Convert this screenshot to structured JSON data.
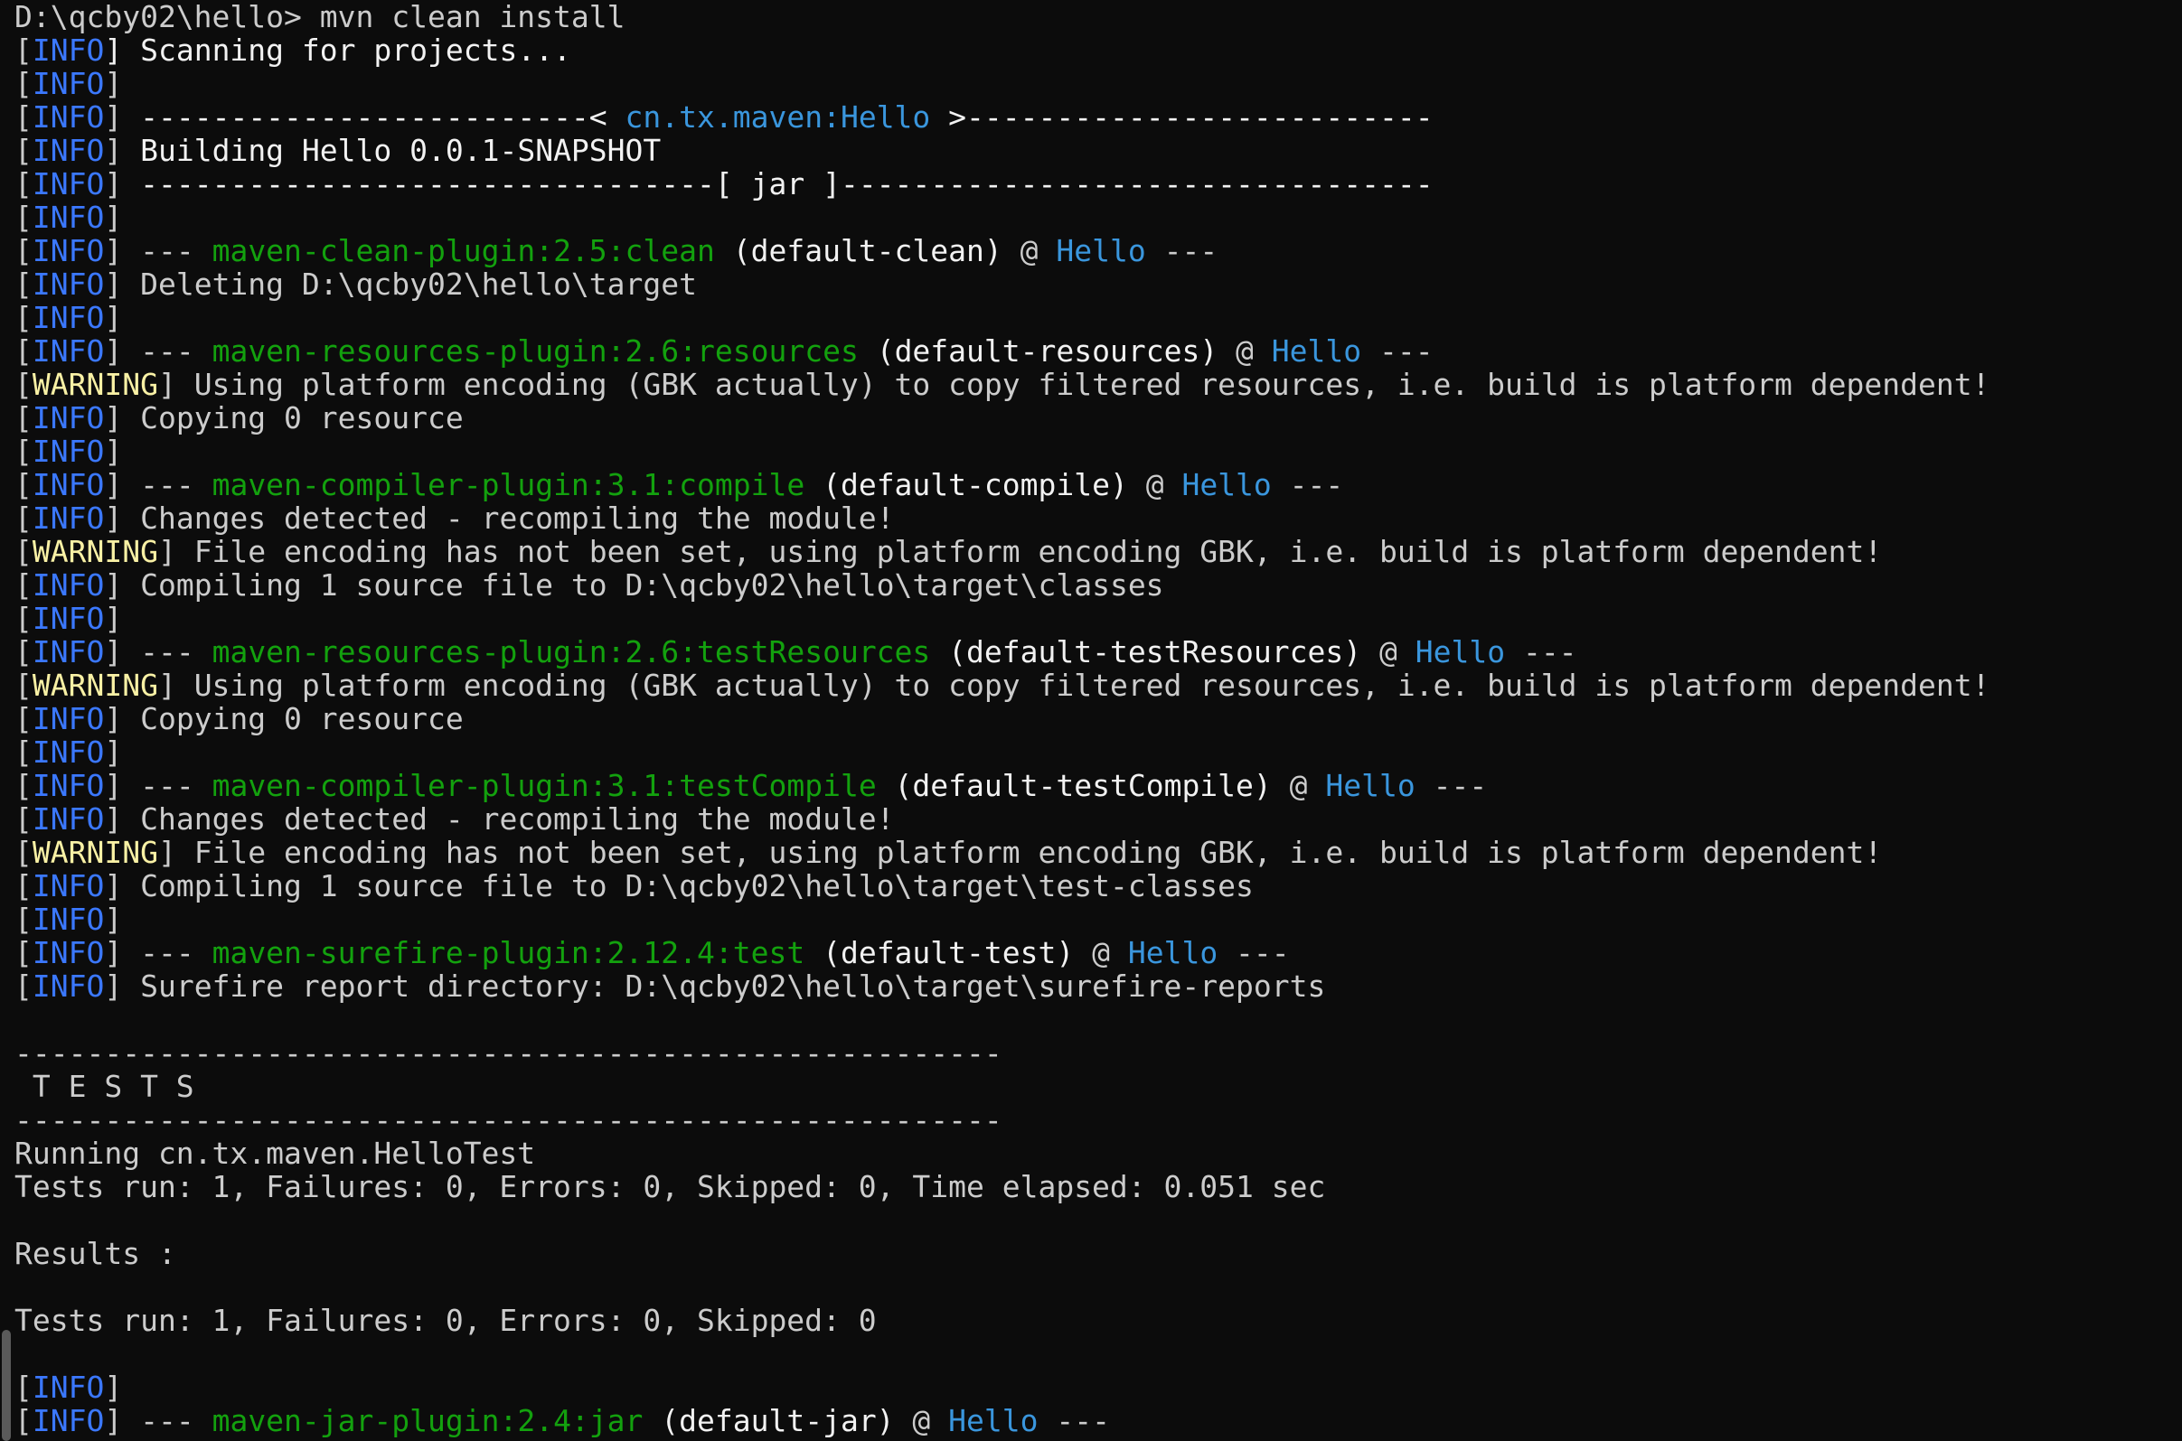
{
  "colors": {
    "background": "#0c0c0c",
    "default": "#cccccc",
    "bright": "#f2f2f2",
    "info": "#3b78ff",
    "warning": "#f9f1a5",
    "plugin": "#13a10e",
    "project": "#3a96dd"
  },
  "terminal": {
    "lines": [
      [
        {
          "text": "D:\\qcby02\\hello> mvn clean install",
          "c": "default"
        }
      ],
      [
        {
          "text": "[",
          "c": "default"
        },
        {
          "text": "INFO",
          "c": "info"
        },
        {
          "text": "] Scanning for projects...",
          "c": "bright"
        }
      ],
      [
        {
          "text": "[",
          "c": "default"
        },
        {
          "text": "INFO",
          "c": "info"
        },
        {
          "text": "]",
          "c": "default"
        }
      ],
      [
        {
          "text": "[",
          "c": "default"
        },
        {
          "text": "INFO",
          "c": "info"
        },
        {
          "text": "] ",
          "c": "default"
        },
        {
          "text": "-------------------------< ",
          "c": "bright"
        },
        {
          "text": "cn.tx.maven:Hello",
          "c": "project"
        },
        {
          "text": " >--------------------------",
          "c": "bright"
        }
      ],
      [
        {
          "text": "[",
          "c": "default"
        },
        {
          "text": "INFO",
          "c": "info"
        },
        {
          "text": "] ",
          "c": "default"
        },
        {
          "text": "Building Hello 0.0.1-SNAPSHOT",
          "c": "bright"
        }
      ],
      [
        {
          "text": "[",
          "c": "default"
        },
        {
          "text": "INFO",
          "c": "info"
        },
        {
          "text": "] ",
          "c": "default"
        },
        {
          "text": "--------------------------------[ jar ]---------------------------------",
          "c": "bright"
        }
      ],
      [
        {
          "text": "[",
          "c": "default"
        },
        {
          "text": "INFO",
          "c": "info"
        },
        {
          "text": "]",
          "c": "default"
        }
      ],
      [
        {
          "text": "[",
          "c": "default"
        },
        {
          "text": "INFO",
          "c": "info"
        },
        {
          "text": "] --- ",
          "c": "default"
        },
        {
          "text": "maven-clean-plugin:2.5:clean",
          "c": "plugin"
        },
        {
          "text": " (default-clean)",
          "c": "bright"
        },
        {
          "text": " @ ",
          "c": "default"
        },
        {
          "text": "Hello",
          "c": "project"
        },
        {
          "text": " ---",
          "c": "default"
        }
      ],
      [
        {
          "text": "[",
          "c": "default"
        },
        {
          "text": "INFO",
          "c": "info"
        },
        {
          "text": "] Deleting D:\\qcby02\\hello\\target",
          "c": "default"
        }
      ],
      [
        {
          "text": "[",
          "c": "default"
        },
        {
          "text": "INFO",
          "c": "info"
        },
        {
          "text": "]",
          "c": "default"
        }
      ],
      [
        {
          "text": "[",
          "c": "default"
        },
        {
          "text": "INFO",
          "c": "info"
        },
        {
          "text": "] --- ",
          "c": "default"
        },
        {
          "text": "maven-resources-plugin:2.6:resources",
          "c": "plugin"
        },
        {
          "text": " (default-resources)",
          "c": "bright"
        },
        {
          "text": " @ ",
          "c": "default"
        },
        {
          "text": "Hello",
          "c": "project"
        },
        {
          "text": " ---",
          "c": "default"
        }
      ],
      [
        {
          "text": "[",
          "c": "default"
        },
        {
          "text": "WARNING",
          "c": "warning"
        },
        {
          "text": "] Using platform encoding (GBK actually) to copy filtered resources, i.e. build is platform dependent!",
          "c": "default"
        }
      ],
      [
        {
          "text": "[",
          "c": "default"
        },
        {
          "text": "INFO",
          "c": "info"
        },
        {
          "text": "] Copying 0 resource",
          "c": "default"
        }
      ],
      [
        {
          "text": "[",
          "c": "default"
        },
        {
          "text": "INFO",
          "c": "info"
        },
        {
          "text": "]",
          "c": "default"
        }
      ],
      [
        {
          "text": "[",
          "c": "default"
        },
        {
          "text": "INFO",
          "c": "info"
        },
        {
          "text": "] --- ",
          "c": "default"
        },
        {
          "text": "maven-compiler-plugin:3.1:compile",
          "c": "plugin"
        },
        {
          "text": " (default-compile)",
          "c": "bright"
        },
        {
          "text": " @ ",
          "c": "default"
        },
        {
          "text": "Hello",
          "c": "project"
        },
        {
          "text": " ---",
          "c": "default"
        }
      ],
      [
        {
          "text": "[",
          "c": "default"
        },
        {
          "text": "INFO",
          "c": "info"
        },
        {
          "text": "] Changes detected - recompiling the module!",
          "c": "default"
        }
      ],
      [
        {
          "text": "[",
          "c": "default"
        },
        {
          "text": "WARNING",
          "c": "warning"
        },
        {
          "text": "] File encoding has not been set, using platform encoding GBK, i.e. build is platform dependent!",
          "c": "default"
        }
      ],
      [
        {
          "text": "[",
          "c": "default"
        },
        {
          "text": "INFO",
          "c": "info"
        },
        {
          "text": "] Compiling 1 source file to D:\\qcby02\\hello\\target\\classes",
          "c": "default"
        }
      ],
      [
        {
          "text": "[",
          "c": "default"
        },
        {
          "text": "INFO",
          "c": "info"
        },
        {
          "text": "]",
          "c": "default"
        }
      ],
      [
        {
          "text": "[",
          "c": "default"
        },
        {
          "text": "INFO",
          "c": "info"
        },
        {
          "text": "] --- ",
          "c": "default"
        },
        {
          "text": "maven-resources-plugin:2.6:testResources",
          "c": "plugin"
        },
        {
          "text": " (default-testResources)",
          "c": "bright"
        },
        {
          "text": " @ ",
          "c": "default"
        },
        {
          "text": "Hello",
          "c": "project"
        },
        {
          "text": " ---",
          "c": "default"
        }
      ],
      [
        {
          "text": "[",
          "c": "default"
        },
        {
          "text": "WARNING",
          "c": "warning"
        },
        {
          "text": "] Using platform encoding (GBK actually) to copy filtered resources, i.e. build is platform dependent!",
          "c": "default"
        }
      ],
      [
        {
          "text": "[",
          "c": "default"
        },
        {
          "text": "INFO",
          "c": "info"
        },
        {
          "text": "] Copying 0 resource",
          "c": "default"
        }
      ],
      [
        {
          "text": "[",
          "c": "default"
        },
        {
          "text": "INFO",
          "c": "info"
        },
        {
          "text": "]",
          "c": "default"
        }
      ],
      [
        {
          "text": "[",
          "c": "default"
        },
        {
          "text": "INFO",
          "c": "info"
        },
        {
          "text": "] --- ",
          "c": "default"
        },
        {
          "text": "maven-compiler-plugin:3.1:testCompile",
          "c": "plugin"
        },
        {
          "text": " (default-testCompile)",
          "c": "bright"
        },
        {
          "text": " @ ",
          "c": "default"
        },
        {
          "text": "Hello",
          "c": "project"
        },
        {
          "text": " ---",
          "c": "default"
        }
      ],
      [
        {
          "text": "[",
          "c": "default"
        },
        {
          "text": "INFO",
          "c": "info"
        },
        {
          "text": "] Changes detected - recompiling the module!",
          "c": "default"
        }
      ],
      [
        {
          "text": "[",
          "c": "default"
        },
        {
          "text": "WARNING",
          "c": "warning"
        },
        {
          "text": "] File encoding has not been set, using platform encoding GBK, i.e. build is platform dependent!",
          "c": "default"
        }
      ],
      [
        {
          "text": "[",
          "c": "default"
        },
        {
          "text": "INFO",
          "c": "info"
        },
        {
          "text": "] Compiling 1 source file to D:\\qcby02\\hello\\target\\test-classes",
          "c": "default"
        }
      ],
      [
        {
          "text": "[",
          "c": "default"
        },
        {
          "text": "INFO",
          "c": "info"
        },
        {
          "text": "]",
          "c": "default"
        }
      ],
      [
        {
          "text": "[",
          "c": "default"
        },
        {
          "text": "INFO",
          "c": "info"
        },
        {
          "text": "] --- ",
          "c": "default"
        },
        {
          "text": "maven-surefire-plugin:2.12.4:test",
          "c": "plugin"
        },
        {
          "text": " (default-test)",
          "c": "bright"
        },
        {
          "text": " @ ",
          "c": "default"
        },
        {
          "text": "Hello",
          "c": "project"
        },
        {
          "text": " ---",
          "c": "default"
        }
      ],
      [
        {
          "text": "[",
          "c": "default"
        },
        {
          "text": "INFO",
          "c": "info"
        },
        {
          "text": "] Surefire report directory: D:\\qcby02\\hello\\target\\surefire-reports",
          "c": "default"
        }
      ],
      [
        {
          "text": "",
          "c": "default"
        }
      ],
      [
        {
          "text": "-------------------------------------------------------",
          "c": "default"
        }
      ],
      [
        {
          "text": " T E S T S",
          "c": "default"
        }
      ],
      [
        {
          "text": "-------------------------------------------------------",
          "c": "default"
        }
      ],
      [
        {
          "text": "Running cn.tx.maven.HelloTest",
          "c": "default"
        }
      ],
      [
        {
          "text": "Tests run: 1, Failures: 0, Errors: 0, Skipped: 0, Time elapsed: 0.051 sec",
          "c": "default"
        }
      ],
      [
        {
          "text": "",
          "c": "default"
        }
      ],
      [
        {
          "text": "Results :",
          "c": "default"
        }
      ],
      [
        {
          "text": "",
          "c": "default"
        }
      ],
      [
        {
          "text": "Tests run: 1, Failures: 0, Errors: 0, Skipped: 0",
          "c": "default"
        }
      ],
      [
        {
          "text": "",
          "c": "default"
        }
      ],
      [
        {
          "text": "[",
          "c": "default"
        },
        {
          "text": "INFO",
          "c": "info"
        },
        {
          "text": "]",
          "c": "default"
        }
      ],
      [
        {
          "text": "[",
          "c": "default"
        },
        {
          "text": "INFO",
          "c": "info"
        },
        {
          "text": "] --- ",
          "c": "default"
        },
        {
          "text": "maven-jar-plugin:2.4:jar",
          "c": "plugin"
        },
        {
          "text": " (default-jar)",
          "c": "bright"
        },
        {
          "text": " @ ",
          "c": "default"
        },
        {
          "text": "Hello",
          "c": "project"
        },
        {
          "text": " ---",
          "c": "default"
        }
      ]
    ]
  }
}
